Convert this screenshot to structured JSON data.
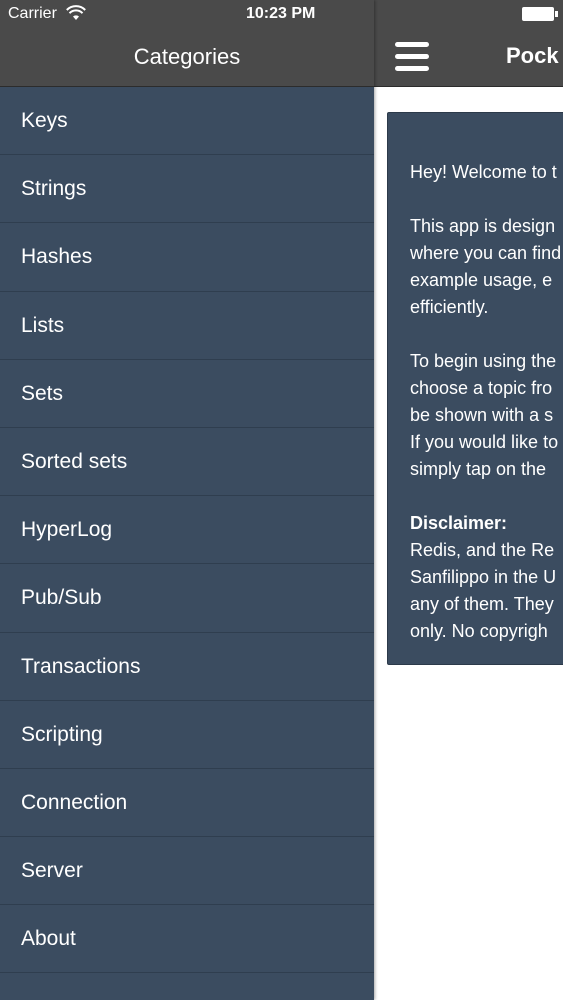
{
  "status_bar": {
    "carrier": "Carrier",
    "time": "10:23 PM"
  },
  "drawer": {
    "title": "Categories",
    "items": [
      {
        "label": "Keys"
      },
      {
        "label": "Strings"
      },
      {
        "label": "Hashes"
      },
      {
        "label": "Lists"
      },
      {
        "label": "Sets"
      },
      {
        "label": "Sorted sets"
      },
      {
        "label": "HyperLog"
      },
      {
        "label": "Pub/Sub"
      },
      {
        "label": "Transactions"
      },
      {
        "label": "Scripting"
      },
      {
        "label": "Connection"
      },
      {
        "label": "Server"
      },
      {
        "label": "About"
      }
    ]
  },
  "main": {
    "title": "Pock",
    "welcome": {
      "greeting": "Hey! Welcome to t",
      "intro": "This app is design\nwhere you can find\nexample usage, e\nefficiently.",
      "instructions": "To begin using the\nchoose a topic fro\nbe shown with a s\nIf you would like to\nsimply tap on the",
      "disclaimer_heading": "Disclaimer:",
      "disclaimer_body": "Redis, and the Re\nSanfilippo in the U\nany of them. They\nonly. No copyrigh"
    }
  },
  "colors": {
    "drawer_bg": "#3b4c60",
    "header_bg": "#4a4a4a",
    "card_bg": "#3b4c60",
    "text": "#ffffff"
  },
  "icons": {
    "wifi": "wifi-icon",
    "battery": "battery-icon",
    "menu": "hamburger-icon"
  }
}
